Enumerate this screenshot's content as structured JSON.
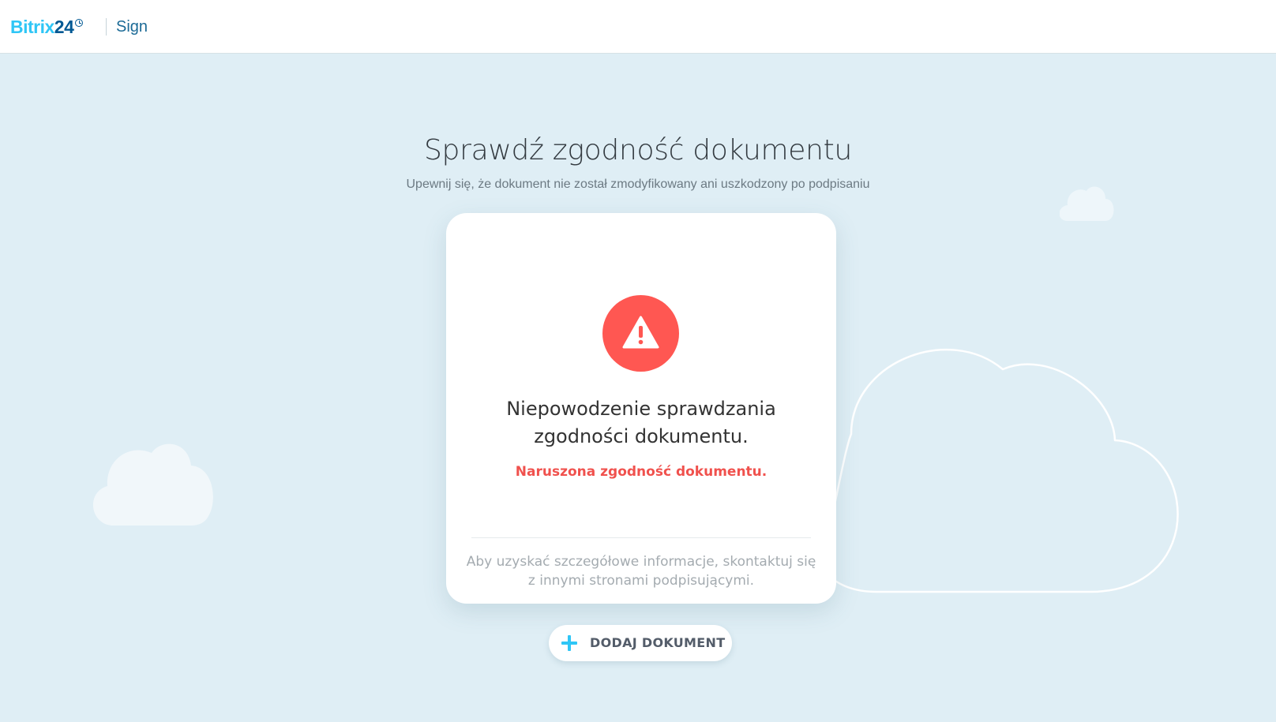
{
  "header": {
    "logo_brand": "Bitrix",
    "logo_number": "24",
    "product": "Sign"
  },
  "main": {
    "title": "Sprawdź zgodność dokumentu",
    "subtitle": "Upewnij się, że dokument nie został zmodyfikowany ani uszkodzony po podpisaniu"
  },
  "card": {
    "icon": "warning-icon",
    "title_line1": "Niepowodzenie sprawdzania",
    "title_line2": "zgodności dokumentu.",
    "error": "Naruszona zgodność dokumentu.",
    "note_line1": "Aby uzyskać szczegółowe informacje, skontaktuj się",
    "note_line2": "z innymi stronami podpisującymi."
  },
  "actions": {
    "add_document_label": "DODAJ DOKUMENT",
    "add_icon": "plus-icon"
  },
  "colors": {
    "background": "#dfeef5",
    "accent": "#2fc6f6",
    "brand_dark": "#005893",
    "error": "#ff5752"
  }
}
